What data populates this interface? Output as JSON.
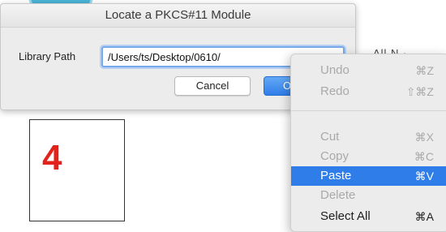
{
  "dialog": {
    "title": "Locate a PKCS#11 Module",
    "field_label": "Library Path",
    "path_value": "/Users/ts/Desktop/0610/",
    "cancel_label": "Cancel",
    "ok_label_partial": "O"
  },
  "background_text": "All  N  ·",
  "step_number": "4",
  "context_menu": {
    "items": [
      {
        "label": "Undo",
        "shortcut": "⌘Z",
        "enabled": false
      },
      {
        "label": "Redo",
        "shortcut": "⇧⌘Z",
        "enabled": false
      },
      {
        "label": "Cut",
        "shortcut": "⌘X",
        "enabled": false
      },
      {
        "label": "Copy",
        "shortcut": "⌘C",
        "enabled": false
      },
      {
        "label": "Paste",
        "shortcut": "⌘V",
        "enabled": true,
        "selected": true
      },
      {
        "label": "Delete",
        "shortcut": "",
        "enabled": false
      },
      {
        "label": "Select All",
        "shortcut": "⌘A",
        "enabled": true
      }
    ]
  },
  "colors": {
    "accent": "#2f7de9",
    "step_number": "#e3231b",
    "decoration": "#4ab3d6"
  }
}
